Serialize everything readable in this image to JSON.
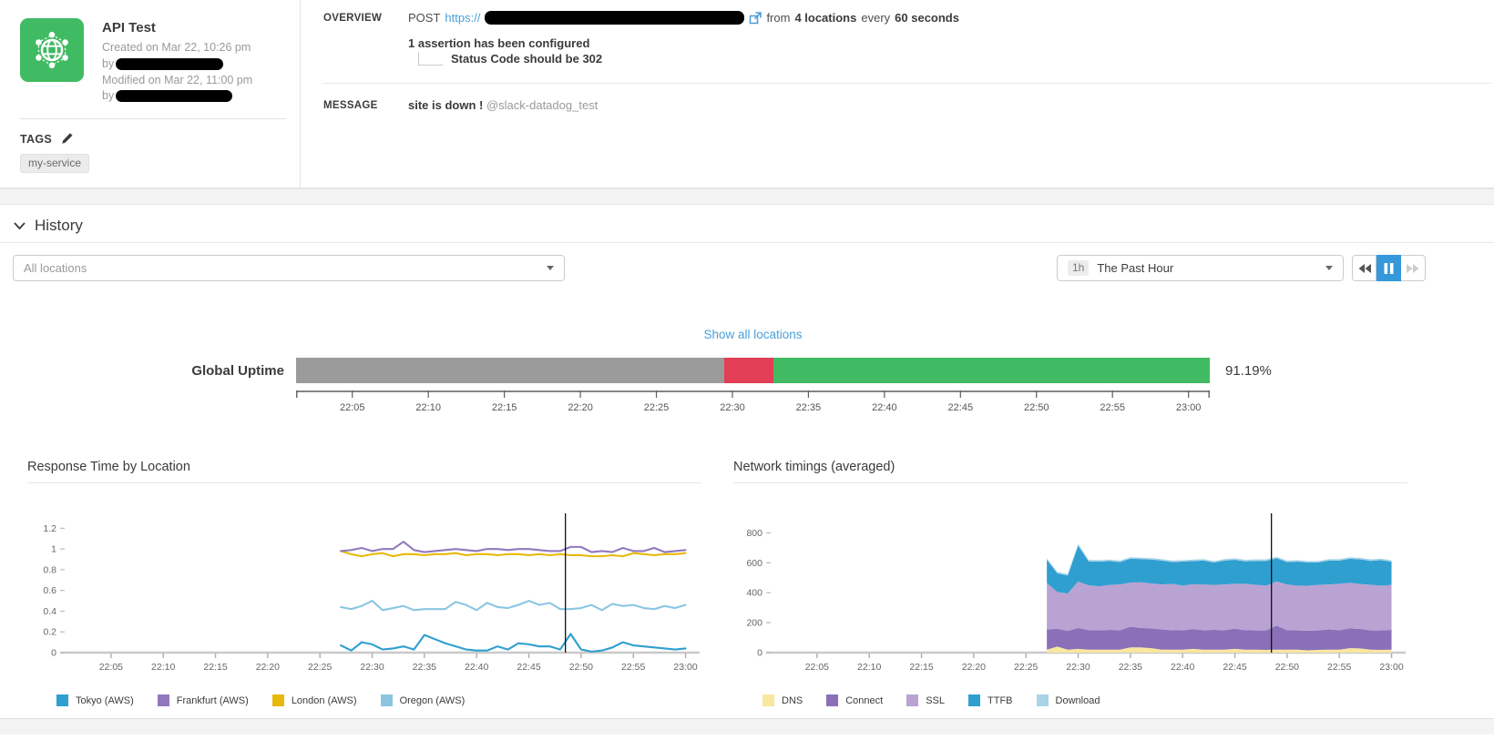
{
  "test_info": {
    "title": "API Test",
    "created_line": "Created on Mar 22, 10:26 pm",
    "created_by_label": "by",
    "modified_line": "Modified on Mar 22, 11:00 pm",
    "modified_by_label": "by",
    "tags_label": "TAGS",
    "tags": [
      "my-service"
    ]
  },
  "overview": {
    "label": "OVERVIEW",
    "method": "POST",
    "url_prefix": "https://",
    "from_text": "from",
    "locations_bold": "4 locations",
    "every_text": "every",
    "interval_bold": "60 seconds",
    "assertion_line": "1 assertion has been configured",
    "assertion_detail": "Status Code should be 302"
  },
  "message": {
    "label": "MESSAGE",
    "text_bold": "site is down !",
    "mention": "@slack-datadog_test"
  },
  "history": {
    "heading": "History",
    "locations_filter_placeholder": "All locations",
    "time_range_badge": "1h",
    "time_range_label": "The Past Hour"
  },
  "uptime": {
    "show_all_link": "Show all locations",
    "label": "Global Uptime",
    "value": "91.19%",
    "segments": [
      {
        "status": "no-data",
        "fraction": 0.469,
        "color": "#9b9b9b"
      },
      {
        "status": "alert",
        "fraction": 0.053,
        "color": "#e23e55"
      },
      {
        "status": "ok",
        "fraction": 0.478,
        "color": "#41bb63"
      }
    ],
    "axis": {
      "start_min": 1.3,
      "end_min": 61.4,
      "tick_minutes": [
        5,
        10,
        15,
        20,
        25,
        30,
        35,
        40,
        45,
        50,
        55,
        60
      ],
      "tick_labels": [
        "22:05",
        "22:10",
        "22:15",
        "22:20",
        "22:25",
        "22:30",
        "22:35",
        "22:40",
        "22:45",
        "22:50",
        "22:55",
        "23:00"
      ]
    }
  },
  "time_axis": {
    "start_min": 1,
    "end_min": 61,
    "tick_minutes": [
      5,
      10,
      15,
      20,
      25,
      30,
      35,
      40,
      45,
      50,
      55,
      60
    ],
    "tick_labels": [
      "22:05",
      "22:10",
      "22:15",
      "22:20",
      "22:25",
      "22:30",
      "22:35",
      "22:40",
      "22:45",
      "22:50",
      "22:55",
      "23:00"
    ]
  },
  "chart_data": [
    {
      "type": "line",
      "title": "Response Time by Location",
      "ylim": [
        0,
        1.3
      ],
      "yticks": [
        0,
        0.2,
        0.4,
        0.6,
        0.8,
        1,
        1.2
      ],
      "x_start_min": 27,
      "cursor_min": 48.5,
      "xlabel": "",
      "ylabel": "",
      "series": [
        {
          "name": "Tokyo (AWS)",
          "color": "#2f9fd0",
          "draw_order": 4,
          "values": [
            0.07,
            0.02,
            0.1,
            0.08,
            0.03,
            0.04,
            0.06,
            0.03,
            0.17,
            0.13,
            0.09,
            0.06,
            0.03,
            0.02,
            0.02,
            0.06,
            0.03,
            0.09,
            0.08,
            0.06,
            0.06,
            0.03,
            0.18,
            0.03,
            0.01,
            0.02,
            0.05,
            0.1,
            0.07,
            0.06,
            0.05,
            0.04,
            0.03,
            0.04
          ]
        },
        {
          "name": "Frankfurt (AWS)",
          "color": "#9179bd",
          "draw_order": 2,
          "values": [
            0.98,
            0.99,
            1.01,
            0.98,
            1.0,
            1.0,
            1.07,
            0.99,
            0.97,
            0.98,
            0.99,
            1.0,
            0.99,
            0.98,
            1.0,
            1.0,
            0.99,
            1.0,
            1.0,
            0.99,
            0.98,
            0.98,
            1.02,
            1.02,
            0.97,
            0.98,
            0.97,
            1.01,
            0.98,
            0.98,
            1.01,
            0.97,
            0.98,
            0.99
          ]
        },
        {
          "name": "London (AWS)",
          "color": "#e8b90a",
          "draw_order": 1,
          "values": [
            0.98,
            0.95,
            0.93,
            0.95,
            0.96,
            0.93,
            0.95,
            0.95,
            0.94,
            0.95,
            0.95,
            0.96,
            0.94,
            0.95,
            0.95,
            0.94,
            0.95,
            0.95,
            0.94,
            0.95,
            0.94,
            0.95,
            0.94,
            0.94,
            0.93,
            0.93,
            0.94,
            0.93,
            0.96,
            0.95,
            0.94,
            0.95,
            0.95,
            0.96
          ]
        },
        {
          "name": "Oregon (AWS)",
          "color": "#8ac6e2",
          "draw_order": 3,
          "values": [
            0.44,
            0.42,
            0.45,
            0.5,
            0.41,
            0.43,
            0.45,
            0.41,
            0.42,
            0.42,
            0.42,
            0.49,
            0.46,
            0.41,
            0.48,
            0.44,
            0.43,
            0.46,
            0.5,
            0.46,
            0.48,
            0.42,
            0.42,
            0.43,
            0.46,
            0.41,
            0.47,
            0.45,
            0.46,
            0.43,
            0.42,
            0.45,
            0.43,
            0.46
          ]
        }
      ]
    },
    {
      "type": "area",
      "stacked": true,
      "title": "Network timings (averaged)",
      "ylim": [
        0,
        900
      ],
      "yticks": [
        0,
        200,
        400,
        600,
        800
      ],
      "x_start_min": 27,
      "cursor_min": 48.5,
      "xlabel": "",
      "ylabel": "",
      "series": [
        {
          "name": "DNS",
          "color": "#f9e7a0",
          "values": [
            20,
            40,
            20,
            25,
            20,
            20,
            20,
            20,
            35,
            35,
            30,
            20,
            20,
            20,
            25,
            20,
            20,
            20,
            25,
            20,
            20,
            18,
            20,
            20,
            20,
            15,
            18,
            20,
            20,
            30,
            28,
            20,
            18,
            20
          ]
        },
        {
          "name": "Connect",
          "color": "#8a70b8",
          "values": [
            135,
            120,
            125,
            140,
            130,
            128,
            132,
            130,
            138,
            130,
            132,
            135,
            130,
            128,
            132,
            130,
            132,
            130,
            135,
            130,
            128,
            130,
            160,
            130,
            128,
            132,
            130,
            135,
            130,
            132,
            130,
            128,
            130,
            132
          ]
        },
        {
          "name": "SSL",
          "color": "#b9a3d3",
          "values": [
            310,
            245,
            250,
            310,
            300,
            295,
            300,
            305,
            295,
            305,
            300,
            300,
            310,
            300,
            300,
            305,
            300,
            305,
            300,
            310,
            305,
            300,
            295,
            305,
            300,
            300,
            305,
            300,
            310,
            305,
            300,
            305,
            300,
            300
          ]
        },
        {
          "name": "TTFB",
          "color": "#2f9fd0",
          "values": [
            155,
            125,
            120,
            240,
            160,
            165,
            160,
            150,
            160,
            155,
            160,
            160,
            145,
            160,
            155,
            160,
            150,
            160,
            160,
            150,
            160,
            165,
            155,
            150,
            160,
            155,
            150,
            160,
            155,
            160,
            165,
            160,
            170,
            155
          ]
        },
        {
          "name": "Download",
          "color": "#a9d4e8",
          "values": [
            10,
            10,
            10,
            10,
            10,
            10,
            10,
            10,
            10,
            10,
            10,
            10,
            10,
            10,
            10,
            10,
            10,
            10,
            10,
            10,
            10,
            10,
            10,
            10,
            10,
            10,
            10,
            10,
            10,
            10,
            10,
            10,
            10,
            10
          ]
        }
      ]
    }
  ]
}
